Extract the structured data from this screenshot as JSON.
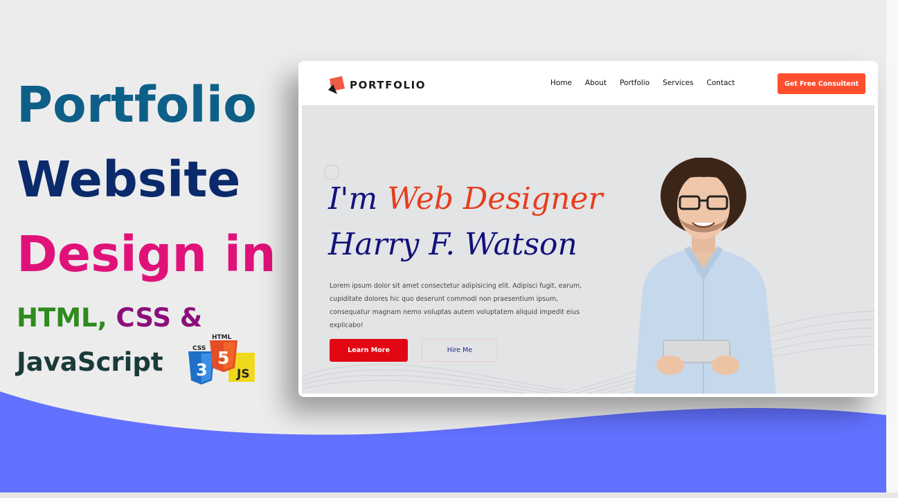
{
  "headline": {
    "line1": "Portfolio",
    "line2": "Website",
    "line3": "Design in",
    "tech_html": "HTML,",
    "tech_css": "CSS",
    "tech_amp": "&",
    "tech_js": "JavaScript"
  },
  "logos": {
    "css_label": "CSS",
    "css_number": "3",
    "html_label": "HTML",
    "html_number": "5",
    "js_label": "JS"
  },
  "site": {
    "brand": "PORTFOLIO",
    "nav": [
      "Home",
      "About",
      "Portfolio",
      "Services",
      "Contact"
    ],
    "cta": "Get Free Consultent",
    "hero": {
      "im": "I'm",
      "role": "Web Designer",
      "name": "Harry F. Watson",
      "description": "Lorem ipsum dolor sit amet consectetur adipisicing elit. Adipisci fugit, earum, cupiditate dolores hic quo deserunt commodi non praesentium ipsum, consequatur magnam nemo voluptas autem voluptatem aliquid impedit eius explicabo!",
      "learn_more": "Learn More",
      "hire_me": "Hire Me"
    }
  },
  "colors": {
    "wave": "#6271ff",
    "accent": "#ff4f2e",
    "navy": "#12127a",
    "red": "#e63d1e"
  }
}
